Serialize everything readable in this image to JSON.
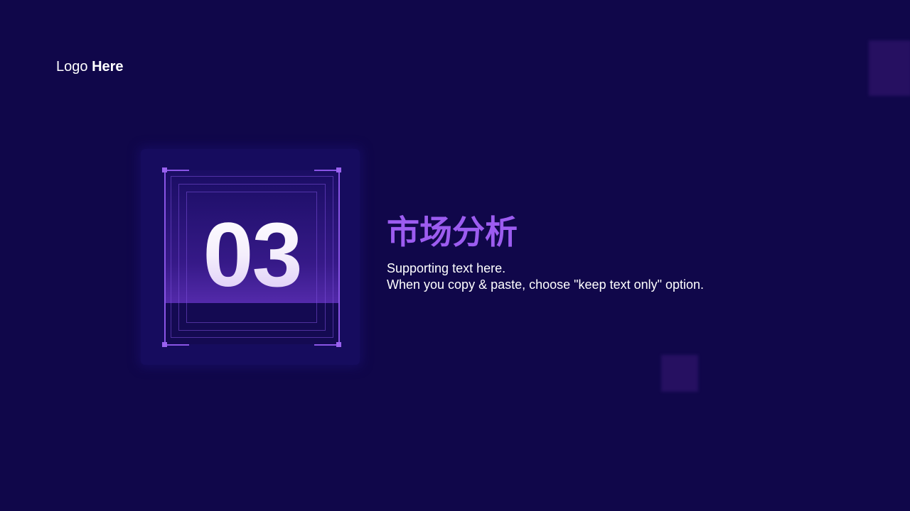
{
  "logo": {
    "text_regular": "Logo",
    "text_bold": "Here"
  },
  "section": {
    "number": "03",
    "title": "市场分析",
    "supporting_line1": "Supporting text here.",
    "supporting_line2": "When you copy & paste, choose \"keep text only\" option."
  },
  "colors": {
    "background": "#10074a",
    "accent": "#9c5cf0",
    "frame": "#8a55e6"
  }
}
